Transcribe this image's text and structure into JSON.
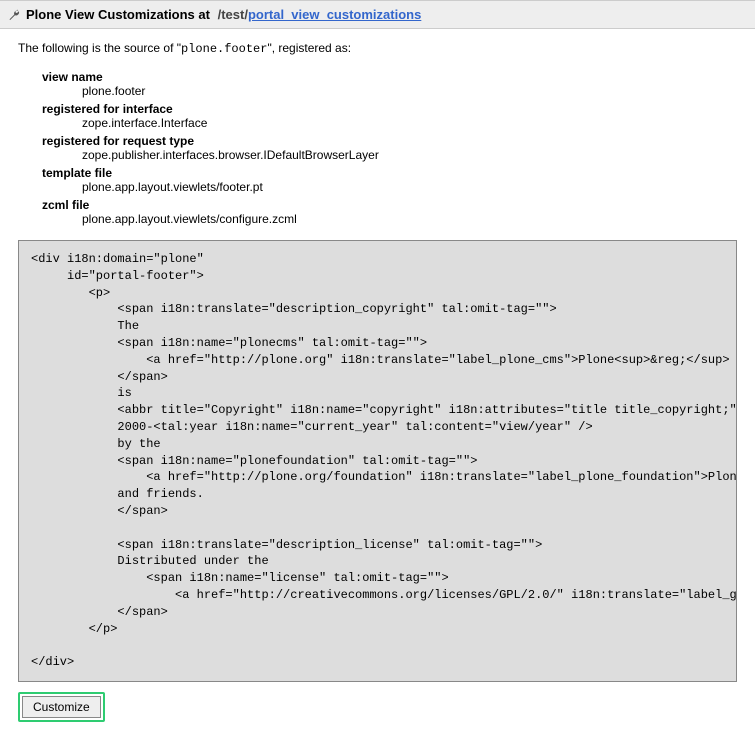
{
  "header": {
    "title": "Plone View Customizations at",
    "path_prefix": "/test/",
    "path_link": "portal_view_customizations"
  },
  "intro": {
    "before": "The following is the source of \"",
    "name": "plone.footer",
    "after": "\", registered as:"
  },
  "details": {
    "view_name_label": "view name",
    "view_name_value": "plone.footer",
    "interface_label": "registered for interface",
    "interface_value": "zope.interface.Interface",
    "request_type_label": "registered for request type",
    "request_type_value": "zope.publisher.interfaces.browser.IDefaultBrowserLayer",
    "template_file_label": "template file",
    "template_file_value": "plone.app.layout.viewlets/footer.pt",
    "zcml_file_label": "zcml file",
    "zcml_file_value": "plone.app.layout.viewlets/configure.zcml"
  },
  "source_code": "<div i18n:domain=\"plone\"\n     id=\"portal-footer\">\n        <p>\n            <span i18n:translate=\"description_copyright\" tal:omit-tag=\"\">\n            The\n            <span i18n:name=\"plonecms\" tal:omit-tag=\"\">\n                <a href=\"http://plone.org\" i18n:translate=\"label_plone_cms\">Plone<sup>&reg;</sup> C\n            </span>\n            is\n            <abbr title=\"Copyright\" i18n:name=\"copyright\" i18n:attributes=\"title title_copyright;\">&\n            2000-<tal:year i18n:name=\"current_year\" tal:content=\"view/year\" />\n            by the\n            <span i18n:name=\"plonefoundation\" tal:omit-tag=\"\">\n                <a href=\"http://plone.org/foundation\" i18n:translate=\"label_plone_foundation\">Plon\n            and friends.\n            </span>\n\n            <span i18n:translate=\"description_license\" tal:omit-tag=\"\">\n            Distributed under the\n                <span i18n:name=\"license\" tal:omit-tag=\"\">\n                    <a href=\"http://creativecommons.org/licenses/GPL/2.0/\" i18n:translate=\"label_g\n            </span>\n        </p>\n\n</div>",
  "button": {
    "customize": "Customize"
  }
}
